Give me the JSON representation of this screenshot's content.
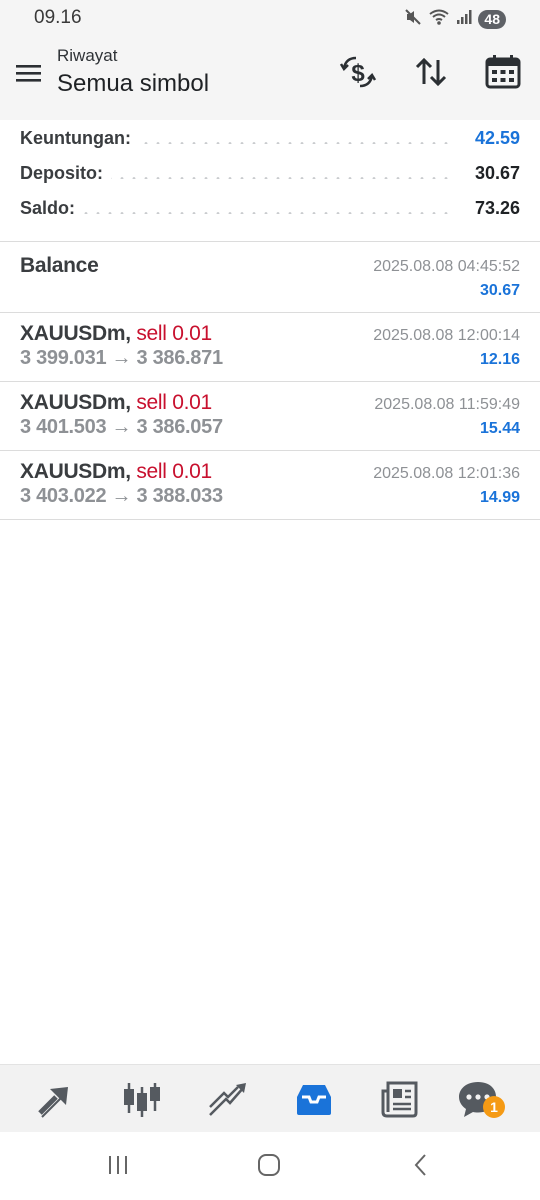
{
  "status_bar": {
    "time": "09.16",
    "battery": "48",
    "icons": [
      "mute-icon",
      "wifi-icon",
      "signal-icon"
    ]
  },
  "header": {
    "subtitle": "Riwayat",
    "title": "Semua simbol",
    "buttons": [
      "currency-exchange-icon",
      "sort-icon",
      "calendar-icon"
    ]
  },
  "summary": {
    "profit_label": "Keuntungan:",
    "profit_value": "42.59",
    "deposit_label": "Deposito:",
    "deposit_value": "30.67",
    "balance_label": "Saldo:",
    "balance_value": "73.26"
  },
  "balance_entry": {
    "label": "Balance",
    "datetime": "2025.08.08 04:45:52",
    "amount": "30.67"
  },
  "trades": [
    {
      "symbol": "XAUUSDm,",
      "action": "sell 0.01",
      "prices": "3 399.031 → 3 386.871",
      "datetime": "2025.08.08 12:00:14",
      "profit": "12.16"
    },
    {
      "symbol": "XAUUSDm,",
      "action": "sell 0.01",
      "prices": "3 401.503 → 3 386.057",
      "datetime": "2025.08.08 11:59:49",
      "profit": "15.44"
    },
    {
      "symbol": "XAUUSDm,",
      "action": "sell 0.01",
      "prices": "3 403.022 → 3 388.033",
      "datetime": "2025.08.08 12:01:36",
      "profit": "14.99"
    }
  ],
  "bottom_nav": {
    "items": [
      "quotes-icon",
      "chart-icon",
      "trade-icon",
      "history-icon",
      "news-icon",
      "chat-icon"
    ],
    "active": "history-icon",
    "chat_badge": "1"
  },
  "colors": {
    "accent": "#1a73d9",
    "sell": "#c8102e",
    "badge": "#f59a14"
  }
}
